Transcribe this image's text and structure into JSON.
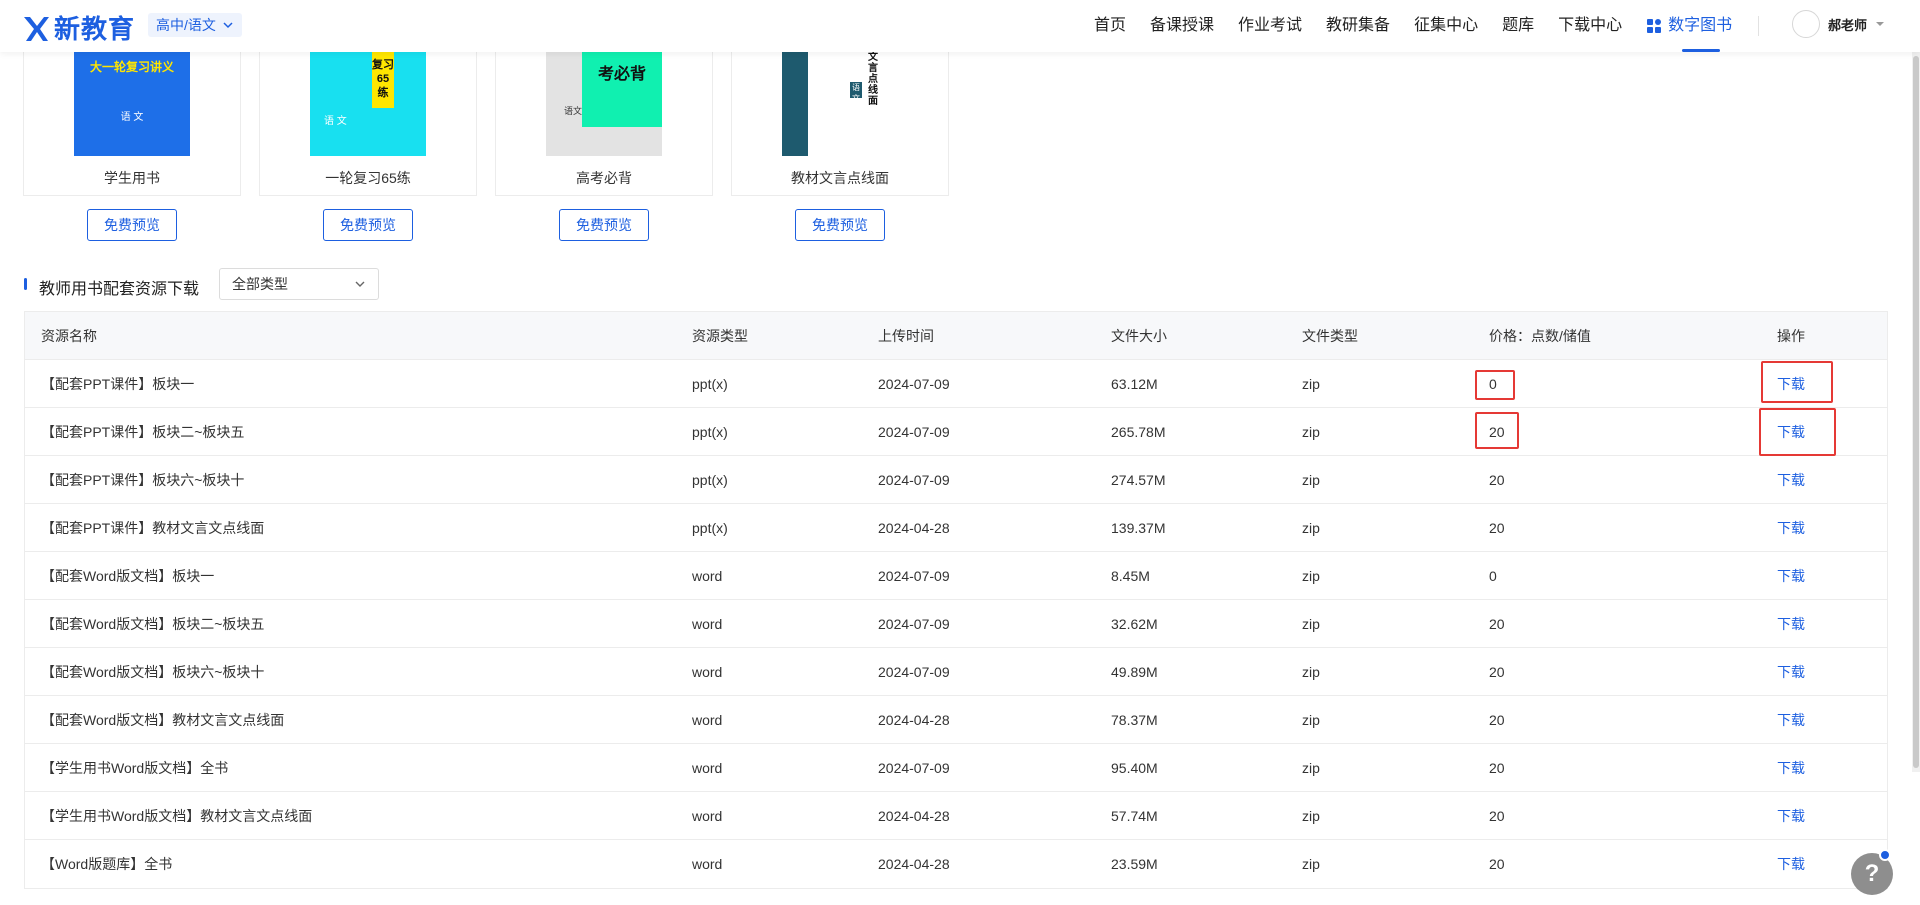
{
  "header": {
    "logo_text": "新教育",
    "grade_select": "高中/语文",
    "nav": [
      "首页",
      "备课授课",
      "作业考试",
      "教研集备",
      "征集中心",
      "题库",
      "下载中心",
      "数字图书"
    ],
    "active_nav": "数字图书",
    "user_name": "郝老师"
  },
  "books": [
    {
      "title": "学生用书",
      "cover_text": "大一轮复习讲义",
      "cover_sub": "语 文",
      "cover_color": "#1e6fe8",
      "preview": "免费预览"
    },
    {
      "title": "一轮复习65练",
      "cover_text": "复习65练",
      "cover_sub": "语 文",
      "cover_color": "#18e0f0",
      "preview": "免费预览"
    },
    {
      "title": "高考必背",
      "cover_text": "考必背",
      "cover_sub": "语文",
      "cover_color": "#10f0b0",
      "preview": "免费预览"
    },
    {
      "title": "教材文言点线面",
      "cover_text": "文言点线面",
      "cover_sub": "语文",
      "cover_color": "#1e5a6e",
      "preview": "免费预览"
    }
  ],
  "section": {
    "title": "教师用书配套资源下载",
    "type_select": "全部类型"
  },
  "table": {
    "headers": [
      "资源名称",
      "资源类型",
      "上传时间",
      "文件大小",
      "文件类型",
      "价格：点数/储值",
      "操作"
    ],
    "rows": [
      {
        "name": "【配套PPT课件】板块一",
        "type": "ppt(x)",
        "date": "2024-07-09",
        "size": "63.12M",
        "ftype": "zip",
        "price": "0",
        "action": "下载"
      },
      {
        "name": "【配套PPT课件】板块二~板块五",
        "type": "ppt(x)",
        "date": "2024-07-09",
        "size": "265.78M",
        "ftype": "zip",
        "price": "20",
        "action": "下载"
      },
      {
        "name": "【配套PPT课件】板块六~板块十",
        "type": "ppt(x)",
        "date": "2024-07-09",
        "size": "274.57M",
        "ftype": "zip",
        "price": "20",
        "action": "下载"
      },
      {
        "name": "【配套PPT课件】教材文言文点线面",
        "type": "ppt(x)",
        "date": "2024-04-28",
        "size": "139.37M",
        "ftype": "zip",
        "price": "20",
        "action": "下载"
      },
      {
        "name": "【配套Word版文档】板块一",
        "type": "word",
        "date": "2024-07-09",
        "size": "8.45M",
        "ftype": "zip",
        "price": "0",
        "action": "下载"
      },
      {
        "name": "【配套Word版文档】板块二~板块五",
        "type": "word",
        "date": "2024-07-09",
        "size": "32.62M",
        "ftype": "zip",
        "price": "20",
        "action": "下载"
      },
      {
        "name": "【配套Word版文档】板块六~板块十",
        "type": "word",
        "date": "2024-07-09",
        "size": "49.89M",
        "ftype": "zip",
        "price": "20",
        "action": "下载"
      },
      {
        "name": "【配套Word版文档】教材文言文点线面",
        "type": "word",
        "date": "2024-04-28",
        "size": "78.37M",
        "ftype": "zip",
        "price": "20",
        "action": "下载"
      },
      {
        "name": "【学生用书Word版文档】全书",
        "type": "word",
        "date": "2024-07-09",
        "size": "95.40M",
        "ftype": "zip",
        "price": "20",
        "action": "下载"
      },
      {
        "name": "【学生用书Word版文档】教材文言文点线面",
        "type": "word",
        "date": "2024-04-28",
        "size": "57.74M",
        "ftype": "zip",
        "price": "20",
        "action": "下载"
      },
      {
        "name": "【Word版题库】全书",
        "type": "word",
        "date": "2024-04-28",
        "size": "23.59M",
        "ftype": "zip",
        "price": "20",
        "action": "下载"
      }
    ]
  },
  "help_label": "?",
  "colors": {
    "accent": "#1d5fe0",
    "highlight": "#e53935"
  }
}
